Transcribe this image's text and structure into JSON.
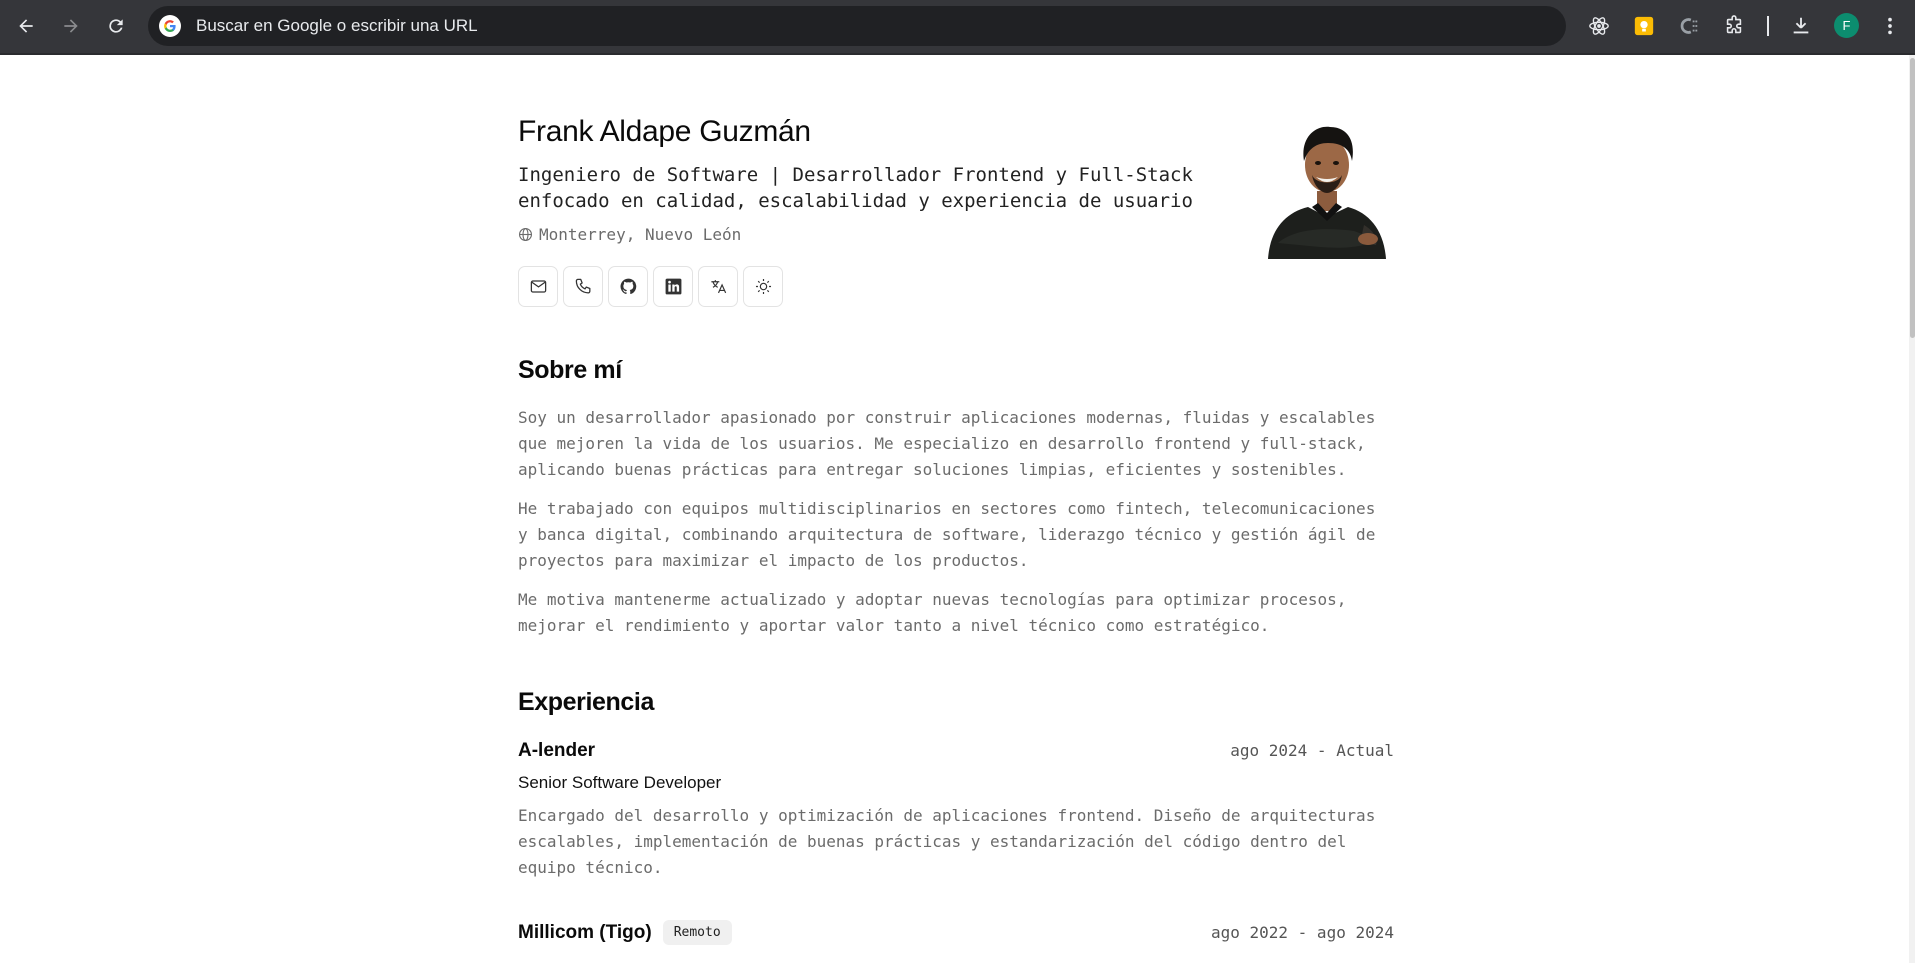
{
  "browser": {
    "omnibox_placeholder": "Buscar en Google o escribir una URL",
    "profile_initial": "F",
    "icons": [
      "back-icon",
      "forward-icon",
      "reload-icon",
      "google-icon",
      "react-devtools-icon",
      "keep-icon",
      "css-extension-icon",
      "extensions-icon",
      "download-icon",
      "menu-icon"
    ]
  },
  "profile": {
    "name": "Frank Aldape Guzmán",
    "headline": "Ingeniero de Software | Desarrollador Frontend y Full-Stack enfocado en calidad, escalabilidad y experiencia de usuario",
    "location": "Monterrey, Nuevo León",
    "contact_icons": [
      "mail-icon",
      "phone-icon",
      "github-icon",
      "linkedin-icon",
      "translate-icon",
      "theme-sun-icon"
    ]
  },
  "about": {
    "title": "Sobre mí",
    "paragraphs": [
      "Soy un desarrollador apasionado por construir aplicaciones modernas, fluidas y escalables que mejoren la vida de los usuarios. Me especializo en desarrollo frontend y full-stack, aplicando buenas prácticas para entregar soluciones limpias, eficientes y sostenibles.",
      "He trabajado con equipos multidisciplinarios en sectores como fintech, telecomunicaciones y banca digital, combinando arquitectura de software, liderazgo técnico y gestión ágil de proyectos para maximizar el impacto de los productos.",
      "Me motiva mantenerme actualizado y adoptar nuevas tecnologías para optimizar procesos, mejorar el rendimiento y aportar valor tanto a nivel técnico como estratégico."
    ]
  },
  "experience": {
    "title": "Experiencia",
    "jobs": [
      {
        "company": "A-lender",
        "dates": "ago 2024 - Actual",
        "role": "Senior Software Developer",
        "description": "Encargado del desarrollo y optimización de aplicaciones frontend. Diseño de arquitecturas escalables, implementación de buenas prácticas y estandarización del código dentro del equipo técnico."
      },
      {
        "company": "Millicom (Tigo)",
        "badge": "Remoto",
        "dates": "ago 2022 - ago 2024"
      }
    ]
  },
  "colors": {
    "chrome_bg": "#35363a",
    "omnibox_bg": "#202124",
    "text_primary": "#0a0a0a",
    "text_muted": "#6b6b6b",
    "avatar_bg": "#0c8d6f"
  }
}
